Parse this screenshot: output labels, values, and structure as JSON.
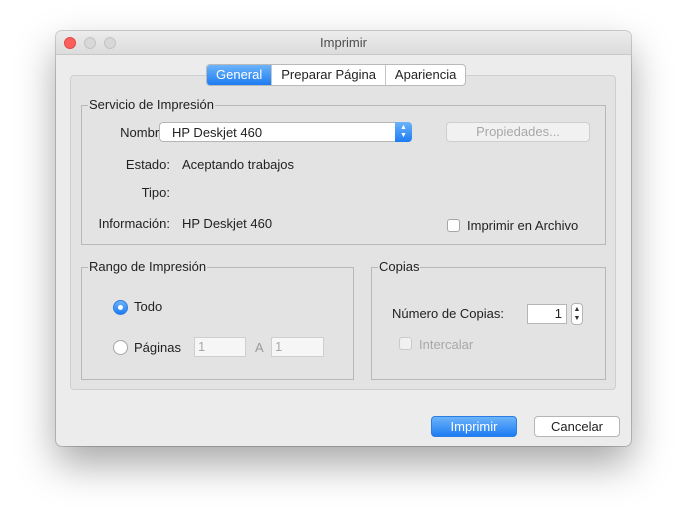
{
  "window": {
    "title": "Imprimir"
  },
  "tabs": [
    {
      "label": "General",
      "active": true
    },
    {
      "label": "Preparar Página",
      "active": false
    },
    {
      "label": "Apariencia",
      "active": false
    }
  ],
  "print_service": {
    "title": "Servicio de Impresión",
    "name_label": "Nombre:",
    "printer": "HP Deskjet 460",
    "properties_button": "Propiedades...",
    "status_label": "Estado:",
    "status_value": "Aceptando trabajos",
    "type_label": "Tipo:",
    "info_label": "Información:",
    "info_value": "HP Deskjet 460",
    "print_to_file_label": "Imprimir en Archivo",
    "print_to_file_checked": false
  },
  "print_range": {
    "title": "Rango de Impresión",
    "all_label": "Todo",
    "all_selected": true,
    "pages_label": "Páginas",
    "from_value": "1",
    "to_label": "A",
    "to_value": "1"
  },
  "copies": {
    "title": "Copias",
    "count_label": "Número de Copias:",
    "count_value": "1",
    "collate_label": "Intercalar",
    "collate_checked": false
  },
  "footer": {
    "print_button": "Imprimir",
    "cancel_button": "Cancelar"
  },
  "colors": {
    "accent": "#1d7cf2",
    "window_bg": "#ececec",
    "close_button": "#fc605c"
  }
}
